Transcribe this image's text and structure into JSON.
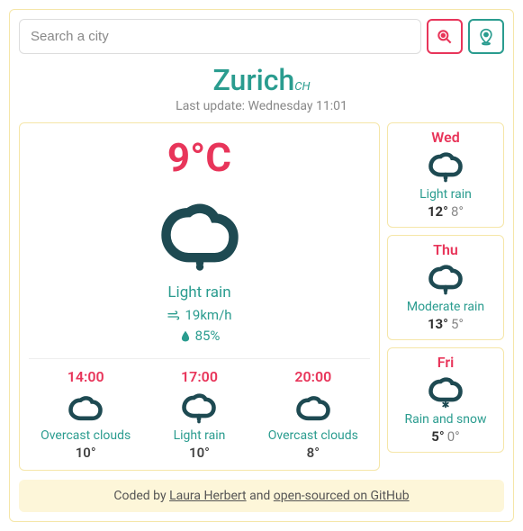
{
  "search": {
    "placeholder": "Search a city"
  },
  "header": {
    "city": "Zurich",
    "country": "CH",
    "updated": "Last update: Wednesday 11:01"
  },
  "current": {
    "temp": "9°C",
    "condition": "Light rain",
    "wind": "19km/h",
    "humidity": "85%"
  },
  "hourly": [
    {
      "time": "14:00",
      "condition": "Overcast clouds",
      "temp": "10°",
      "icon": "cloud"
    },
    {
      "time": "17:00",
      "condition": "Light rain",
      "temp": "10°",
      "icon": "rain"
    },
    {
      "time": "20:00",
      "condition": "Overcast clouds",
      "temp": "8°",
      "icon": "cloud"
    }
  ],
  "forecast": [
    {
      "day": "Wed",
      "condition": "Light rain",
      "hi": "12°",
      "lo": "8°",
      "icon": "rain"
    },
    {
      "day": "Thu",
      "condition": "Moderate rain",
      "hi": "13°",
      "lo": "5°",
      "icon": "rain"
    },
    {
      "day": "Fri",
      "condition": "Rain and snow",
      "hi": "5°",
      "lo": "0°",
      "icon": "snow"
    }
  ],
  "footer": {
    "prefix": "Coded by ",
    "author": "Laura Herbert",
    "mid": " and ",
    "link": "open-sourced on GitHub"
  }
}
